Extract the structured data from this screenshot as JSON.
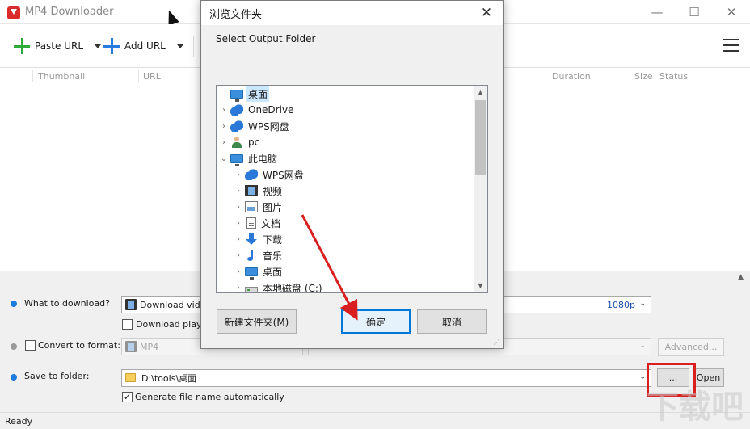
{
  "app": {
    "title": "MP4 Downloader",
    "win_controls": {
      "minimize": "—",
      "maximize": "☐",
      "close": "✕"
    }
  },
  "toolbar": {
    "paste_url": "Paste URL",
    "add_url": "Add URL"
  },
  "columns": [
    "Thumbnail",
    "URL",
    "Duration",
    "Size",
    "Status"
  ],
  "options": {
    "what_label": "What to download?",
    "what_value": "Download video",
    "quality": "1080p",
    "download_playlist": "Download playlist",
    "convert_label": "Convert to format:",
    "format_value": "MP4",
    "advanced": "Advanced...",
    "save_label": "Save to folder:",
    "folder_path": "D:\\tools\\桌面",
    "browse": "...",
    "open": "Open",
    "auto_name": "Generate file name automatically"
  },
  "status": "Ready",
  "dialog": {
    "title": "浏览文件夹",
    "close": "✕",
    "instruction": "Select Output Folder",
    "tree": [
      {
        "label": "桌面",
        "icon": "desktop-icon",
        "indent": 0,
        "twisty": "",
        "selected": true
      },
      {
        "label": "OneDrive",
        "icon": "cloud-icon",
        "indent": 0,
        "twisty": "›"
      },
      {
        "label": "WPS网盘",
        "icon": "cloud-icon",
        "indent": 0,
        "twisty": "›"
      },
      {
        "label": "pc",
        "icon": "user-icon",
        "indent": 0,
        "twisty": "›"
      },
      {
        "label": "此电脑",
        "icon": "computer-icon",
        "indent": 0,
        "twisty": "⌄"
      },
      {
        "label": "WPS网盘",
        "icon": "cloud-icon",
        "indent": 1,
        "twisty": "›"
      },
      {
        "label": "视频",
        "icon": "video-folder-icon",
        "indent": 1,
        "twisty": "›"
      },
      {
        "label": "图片",
        "icon": "picture-folder-icon",
        "indent": 1,
        "twisty": "›"
      },
      {
        "label": "文档",
        "icon": "document-folder-icon",
        "indent": 1,
        "twisty": "›"
      },
      {
        "label": "下载",
        "icon": "download-folder-icon",
        "indent": 1,
        "twisty": "›"
      },
      {
        "label": "音乐",
        "icon": "music-folder-icon",
        "indent": 1,
        "twisty": "›"
      },
      {
        "label": "桌面",
        "icon": "desktop-icon",
        "indent": 1,
        "twisty": "›"
      },
      {
        "label": "本地磁盘 (C:)",
        "icon": "drive-icon",
        "indent": 1,
        "twisty": "›"
      }
    ],
    "new_folder": "新建文件夹(M)",
    "ok": "确定",
    "cancel": "取消"
  },
  "colors": {
    "accent": "#0078d7",
    "annotation_red": "#d81e1e",
    "plus_green": "#2eaa3a",
    "plus_blue": "#2a7be0"
  }
}
